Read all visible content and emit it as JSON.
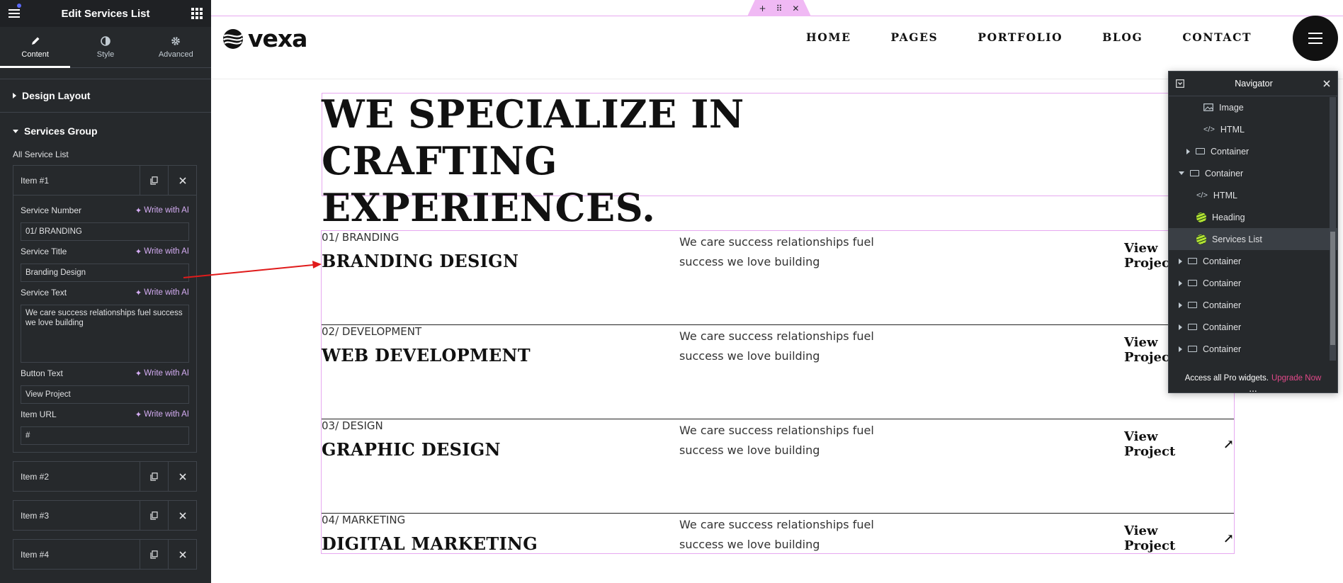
{
  "panel": {
    "title": "Edit Services List",
    "tabs": [
      {
        "label": "Content",
        "icon": "pencil-icon"
      },
      {
        "label": "Style",
        "icon": "contrast-icon"
      },
      {
        "label": "Advanced",
        "icon": "gear-icon"
      }
    ],
    "sections": {
      "design_layout": "Design Layout",
      "services_group": "Services Group"
    },
    "all_service_list": "All Service List",
    "item1": {
      "label": "Item #1",
      "fields": {
        "service_number": {
          "label": "Service Number",
          "value": "01/ BRANDING"
        },
        "service_title": {
          "label": "Service Title",
          "value": "Branding Design"
        },
        "service_text": {
          "label": "Service Text",
          "value": "We care success relationships fuel success we love building"
        },
        "button_text": {
          "label": "Button Text",
          "value": "View Project"
        },
        "item_url": {
          "label": "Item URL",
          "value": "#"
        }
      },
      "write_ai": "Write with AI"
    },
    "items": [
      "Item #2",
      "Item #3",
      "Item #4"
    ]
  },
  "site": {
    "logo": "vexa",
    "nav": [
      "HOME",
      "PAGES",
      "PORTFOLIO",
      "BLOG",
      "CONTACT"
    ],
    "headline_line1": "WE SPECIALIZE IN CRAFTING",
    "headline_line2": "EXPERIENCES.",
    "services": [
      {
        "number": "01/ BRANDING",
        "title": "BRANDING DESIGN",
        "text": "We care success relationships fuel success we love building",
        "cta": "View Project"
      },
      {
        "number": "02/ DEVELOPMENT",
        "title": "WEB DEVELOPMENT",
        "text": "We care success relationships fuel success we love building",
        "cta": "View Project"
      },
      {
        "number": "03/ DESIGN",
        "title": "GRAPHIC DESIGN",
        "text": "We care success relationships fuel success we love building",
        "cta": "View Project"
      },
      {
        "number": "04/ MARKETING",
        "title": "DIGITAL MARKETING",
        "text": "We care success relationships fuel success we love building",
        "cta": "View Project"
      }
    ]
  },
  "navigator": {
    "title": "Navigator",
    "rows": [
      "Image",
      "HTML",
      "Container",
      "Container",
      "HTML",
      "Heading",
      "Services List",
      "Container",
      "Container",
      "Container",
      "Container",
      "Container"
    ],
    "footer_text": "Access all Pro widgets.",
    "footer_link": "Upgrade Now",
    "dots": "..."
  },
  "colors": {
    "panel_bg": "#26292c",
    "accent_pink": "#e6a8f0",
    "ai_purple": "#d5adf4",
    "upgrade": "#e2498a",
    "arrow": "#e01b1b"
  }
}
